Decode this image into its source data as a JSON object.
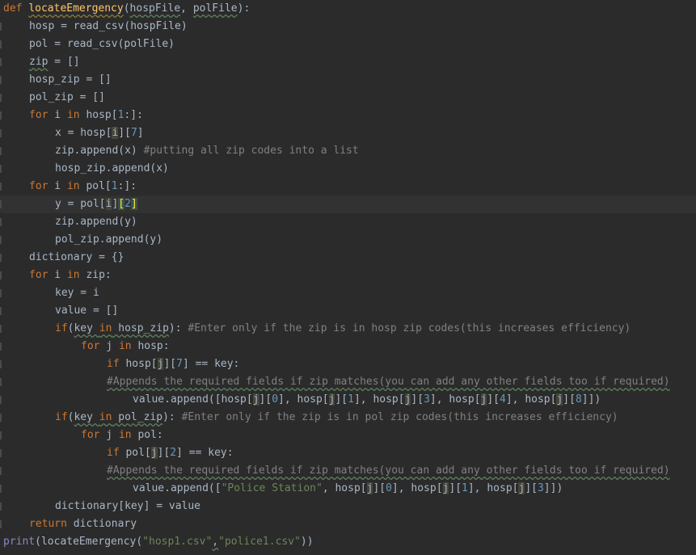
{
  "editor": {
    "lines": [
      {
        "tokens": [
          {
            "t": "def",
            "c": "kw"
          },
          {
            "t": " "
          },
          {
            "t": "locateEmergency",
            "c": "fn warn-y"
          },
          {
            "t": "("
          },
          {
            "t": "hospFile",
            "c": "warn"
          },
          {
            "t": ", "
          },
          {
            "t": "polFile",
            "c": "warn"
          },
          {
            "t": "):"
          }
        ]
      },
      {
        "indent": 1,
        "tokens": [
          {
            "t": "hosp = read_csv(hospFile)"
          }
        ]
      },
      {
        "indent": 1,
        "tokens": [
          {
            "t": "pol = read_csv(polFile)"
          }
        ]
      },
      {
        "indent": 1,
        "tokens": [
          {
            "t": "zip",
            "c": "warn"
          },
          {
            "t": " = []"
          }
        ]
      },
      {
        "indent": 1,
        "tokens": [
          {
            "t": "hosp_zip = []"
          }
        ]
      },
      {
        "indent": 1,
        "tokens": [
          {
            "t": "pol_zip = []"
          }
        ]
      },
      {
        "indent": 1,
        "tokens": [
          {
            "t": "for",
            "c": "kw"
          },
          {
            "t": " i "
          },
          {
            "t": "in",
            "c": "kw"
          },
          {
            "t": " hosp["
          },
          {
            "t": "1",
            "c": "num"
          },
          {
            "t": ":]:"
          }
        ]
      },
      {
        "indent": 2,
        "tokens": [
          {
            "t": "x = hosp["
          },
          {
            "t": "i",
            "c": "hl"
          },
          {
            "t": "]["
          },
          {
            "t": "7",
            "c": "num"
          },
          {
            "t": "]"
          }
        ]
      },
      {
        "indent": 2,
        "tokens": [
          {
            "t": "zip.append(x) "
          },
          {
            "t": "#putting all zip codes into a list",
            "c": "cm"
          }
        ]
      },
      {
        "indent": 2,
        "tokens": [
          {
            "t": "hosp_zip.append(x)"
          }
        ]
      },
      {
        "indent": 1,
        "tokens": [
          {
            "t": "for",
            "c": "kw"
          },
          {
            "t": " i "
          },
          {
            "t": "in",
            "c": "kw"
          },
          {
            "t": " pol["
          },
          {
            "t": "1",
            "c": "num"
          },
          {
            "t": ":]:"
          }
        ]
      },
      {
        "indent": 2,
        "current": true,
        "tokens": [
          {
            "t": "y = pol["
          },
          {
            "t": "i",
            "c": "hl"
          },
          {
            "t": "]"
          },
          {
            "t": "[",
            "c": "hlbr"
          },
          {
            "t": "2",
            "c": "num"
          },
          {
            "t": "]",
            "c": "hlbr"
          }
        ]
      },
      {
        "indent": 2,
        "tokens": [
          {
            "t": "zip.append(y)"
          }
        ]
      },
      {
        "indent": 2,
        "tokens": [
          {
            "t": "pol_zip.append(y)"
          }
        ]
      },
      {
        "indent": 1,
        "tokens": [
          {
            "t": "dictionary = {}"
          }
        ]
      },
      {
        "indent": 1,
        "tokens": [
          {
            "t": "for",
            "c": "kw"
          },
          {
            "t": " i "
          },
          {
            "t": "in",
            "c": "kw"
          },
          {
            "t": " zip:"
          }
        ]
      },
      {
        "indent": 2,
        "tokens": [
          {
            "t": "key = i"
          }
        ]
      },
      {
        "indent": 2,
        "tokens": [
          {
            "t": "value = []"
          }
        ]
      },
      {
        "indent": 2,
        "tokens": [
          {
            "t": "if",
            "c": "kw"
          },
          {
            "t": "("
          },
          {
            "t": "key ",
            "c": "warn"
          },
          {
            "t": "in",
            "c": "kw warn"
          },
          {
            "t": " hosp_zip",
            "c": "warn"
          },
          {
            "t": "): "
          },
          {
            "t": "#Enter only if the zip is in hosp zip codes(this increases efficiency)",
            "c": "cm"
          }
        ]
      },
      {
        "indent": 3,
        "tokens": [
          {
            "t": "for",
            "c": "kw"
          },
          {
            "t": " j "
          },
          {
            "t": "in",
            "c": "kw"
          },
          {
            "t": " hosp:"
          }
        ]
      },
      {
        "indent": 4,
        "tokens": [
          {
            "t": "if",
            "c": "kw"
          },
          {
            "t": " hosp["
          },
          {
            "t": "j",
            "c": "hl"
          },
          {
            "t": "]["
          },
          {
            "t": "7",
            "c": "num"
          },
          {
            "t": "] == key:"
          }
        ]
      },
      {
        "indent": 4,
        "tokens": [
          {
            "t": "#Appends the required fields if zip matches(you can add any other fields too if required)",
            "c": "cm warn"
          }
        ]
      },
      {
        "indent": 5,
        "tokens": [
          {
            "t": "value.append([hosp["
          },
          {
            "t": "j",
            "c": "hl"
          },
          {
            "t": "]["
          },
          {
            "t": "0",
            "c": "num"
          },
          {
            "t": "], hosp["
          },
          {
            "t": "j",
            "c": "hl"
          },
          {
            "t": "]["
          },
          {
            "t": "1",
            "c": "num"
          },
          {
            "t": "], hosp["
          },
          {
            "t": "j",
            "c": "hl"
          },
          {
            "t": "]["
          },
          {
            "t": "3",
            "c": "num"
          },
          {
            "t": "], hosp["
          },
          {
            "t": "j",
            "c": "hl"
          },
          {
            "t": "]["
          },
          {
            "t": "4",
            "c": "num"
          },
          {
            "t": "], hosp["
          },
          {
            "t": "j",
            "c": "hl"
          },
          {
            "t": "]["
          },
          {
            "t": "8",
            "c": "num"
          },
          {
            "t": "]])"
          }
        ]
      },
      {
        "indent": 2,
        "tokens": [
          {
            "t": "if",
            "c": "kw"
          },
          {
            "t": "("
          },
          {
            "t": "key ",
            "c": "warn"
          },
          {
            "t": "in",
            "c": "kw warn"
          },
          {
            "t": " pol_zip",
            "c": "warn"
          },
          {
            "t": "): "
          },
          {
            "t": "#Enter only if the zip is in pol zip codes(this increases efficiency)",
            "c": "cm"
          }
        ]
      },
      {
        "indent": 3,
        "tokens": [
          {
            "t": "for",
            "c": "kw"
          },
          {
            "t": " j "
          },
          {
            "t": "in",
            "c": "kw"
          },
          {
            "t": " pol:"
          }
        ]
      },
      {
        "indent": 4,
        "tokens": [
          {
            "t": "if",
            "c": "kw"
          },
          {
            "t": " pol["
          },
          {
            "t": "j",
            "c": "hl"
          },
          {
            "t": "]["
          },
          {
            "t": "2",
            "c": "num"
          },
          {
            "t": "] == key:"
          }
        ]
      },
      {
        "indent": 4,
        "tokens": [
          {
            "t": "#Appends the required fields if zip matches(you can add any other fields too if required)",
            "c": "cm warn"
          }
        ]
      },
      {
        "indent": 5,
        "tokens": [
          {
            "t": "value.append(["
          },
          {
            "t": "\"Police Station\"",
            "c": "str"
          },
          {
            "t": ", hosp["
          },
          {
            "t": "j",
            "c": "hl"
          },
          {
            "t": "]["
          },
          {
            "t": "0",
            "c": "num"
          },
          {
            "t": "], hosp["
          },
          {
            "t": "j",
            "c": "hl"
          },
          {
            "t": "]["
          },
          {
            "t": "1",
            "c": "num"
          },
          {
            "t": "], hosp["
          },
          {
            "t": "j",
            "c": "hl"
          },
          {
            "t": "]["
          },
          {
            "t": "3",
            "c": "num"
          },
          {
            "t": "]])"
          }
        ]
      },
      {
        "indent": 2,
        "tokens": [
          {
            "t": "dictionary[key] = value"
          }
        ]
      },
      {
        "indent": 1,
        "tokens": [
          {
            "t": "return",
            "c": "kw"
          },
          {
            "t": " dictionary"
          }
        ]
      },
      {
        "tokens": [
          {
            "t": "print",
            "c": "bi"
          },
          {
            "t": "(locateEmergency("
          },
          {
            "t": "\"hosp1.csv\"",
            "c": "str"
          },
          {
            "t": ",",
            "c": "warn"
          },
          {
            "t": "\"police1.csv\"",
            "c": "str"
          },
          {
            "t": "))"
          }
        ]
      }
    ]
  }
}
